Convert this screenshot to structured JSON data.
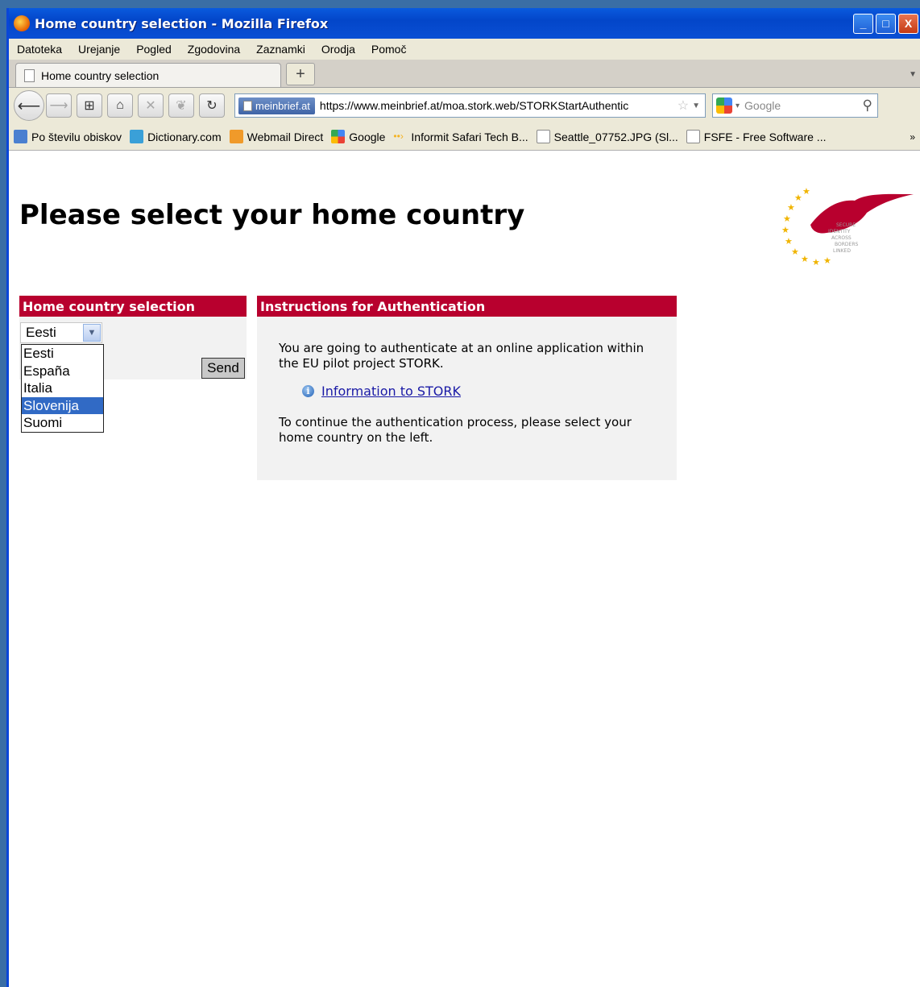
{
  "window": {
    "title": "Home country selection - Mozilla Firefox",
    "controls": [
      "_",
      "□",
      "X"
    ]
  },
  "menu": [
    "Datoteka",
    "Urejanje",
    "Pogled",
    "Zgodovina",
    "Zaznamki",
    "Orodja",
    "Pomoč"
  ],
  "tab": {
    "label": "Home country selection",
    "new_tab": "+"
  },
  "navbar": {
    "site_identity": "meinbrief.at",
    "url": "https://www.meinbrief.at/moa.stork.web/STORKStartAuthentic",
    "search_placeholder": "Google"
  },
  "bookmarks": [
    {
      "label": "Po številu obiskov",
      "icon": "page-icon",
      "color": "#4a7fd0"
    },
    {
      "label": "Dictionary.com",
      "icon": "dictionary-icon",
      "color": "#3aa0d8"
    },
    {
      "label": "Webmail Direct",
      "icon": "mail-icon",
      "color": "#f09a2a"
    },
    {
      "label": "Google",
      "icon": "google-icon",
      "color": "#4285f4"
    },
    {
      "label": "Informit Safari Tech B...",
      "icon": "arrow-icon",
      "color": "#f5b322"
    },
    {
      "label": "Seattle_07752.JPG (Sl...",
      "icon": "page-icon",
      "color": "#ffffff"
    },
    {
      "label": "FSFE - Free Software ...",
      "icon": "page-icon",
      "color": "#ffffff"
    }
  ],
  "page": {
    "heading": "Please select your home country",
    "left_panel": {
      "title": "Home country selection",
      "selected_value": "Eesti",
      "options": [
        "Eesti",
        "España",
        "Italia",
        "Slovenija",
        "Suomi"
      ],
      "highlighted_option": "Slovenija",
      "send_label": "Send"
    },
    "right_panel": {
      "title": "Instructions for Authentication",
      "paragraph1": "You are going to authenticate at an online application within the EU pilot project STORK.",
      "link": "Information to STORK",
      "paragraph2": "To continue the authentication process, please select your home country on the left."
    },
    "logo_text": [
      "SECURE",
      "IDENTITY",
      "ACROSS",
      "BORDERS",
      "LINKED"
    ]
  },
  "colors": {
    "accent_red": "#b8002e",
    "panel_bg": "#f2f2f2",
    "selection_blue": "#316ac5"
  }
}
